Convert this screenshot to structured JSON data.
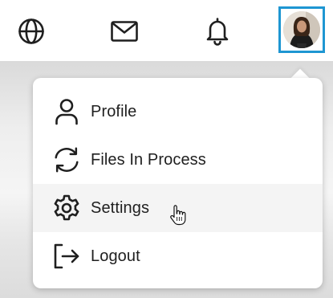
{
  "topbar": {
    "icons": [
      "globe-icon",
      "mail-icon",
      "bell-icon"
    ],
    "avatar_selected_border_color": "#1e96d2"
  },
  "menu": {
    "items": [
      {
        "label": "Profile",
        "icon": "user-icon"
      },
      {
        "label": "Files In Process",
        "icon": "refresh-icon"
      },
      {
        "label": "Settings",
        "icon": "gear-icon",
        "hovered": true
      },
      {
        "label": "Logout",
        "icon": "logout-icon"
      }
    ]
  },
  "cursor": {
    "icon": "hand-pointer-icon"
  }
}
